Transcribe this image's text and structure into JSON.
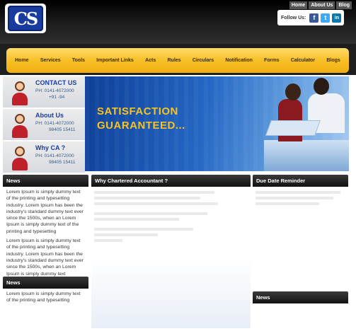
{
  "header": {
    "logo_text": "CS",
    "toplinks": [
      "Home",
      "About Us",
      "Blog"
    ],
    "follow_label": "Follow Us:",
    "social_icons": [
      "facebook-icon",
      "twitter-icon",
      "linkedin-icon"
    ]
  },
  "nav": {
    "items": [
      "Home",
      "Services",
      "Tools",
      "Important Links",
      "Acts",
      "Rules",
      "Circulars",
      "Notification",
      "Forms",
      "Calculator",
      "Blogs"
    ]
  },
  "contacts": [
    {
      "title": "CONTACT US",
      "phone1": "PH: 0141-4072000",
      "phone2": "+91 -94"
    },
    {
      "title": "About Us",
      "phone1": "PH: 0141-4072000",
      "phone2": "98405 15411"
    },
    {
      "title": "Why CA ?",
      "phone1": "PH: 0141-4072000",
      "phone2": "98405 15411"
    }
  ],
  "banner": {
    "line1": "SATISFACTION",
    "line2": "GUARANTEED..."
  },
  "news1": {
    "title": "News",
    "para1": "Lorem Ipsum is simply dummy text of the printing and typesetting industry. Lorem Ipsum has been the industry's standard dummy text ever since the 1500s, when an Lorem Ipsum is simply dummy text of the printing and typesetting",
    "para2": "Lorem Ipsum is simply dummy text of the printing and typesetting industry. Lorem Ipsum has been the industry's standard dummy text ever since the 1500s, when an Lorem Ipsum is simply dummy text"
  },
  "news2": {
    "title": "News",
    "para1": "Lorem Ipsum is simply dummy text of the printing and typesetting"
  },
  "why": {
    "title": "Why Chartered Accountant ?"
  },
  "due": {
    "title": "Due Date Reminder"
  },
  "news3": {
    "title": "News"
  }
}
